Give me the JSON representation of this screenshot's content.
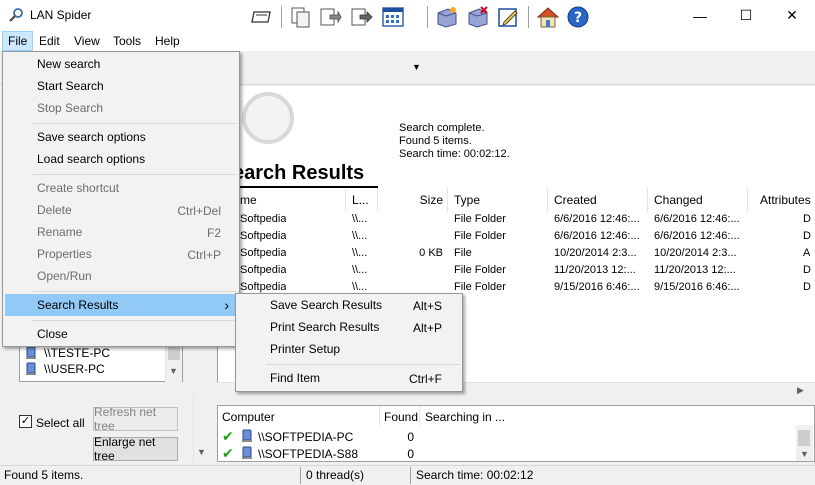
{
  "window": {
    "title": "LAN Spider",
    "minimize": "—",
    "maximize": "☐",
    "close": "✕"
  },
  "menubar": [
    "File",
    "Edit",
    "View",
    "Tools",
    "Help"
  ],
  "file_menu": {
    "items": [
      {
        "label": "New search",
        "shortcut": "",
        "disabled": false
      },
      {
        "label": "Start Search",
        "shortcut": "",
        "disabled": false
      },
      {
        "label": "Stop Search",
        "shortcut": "",
        "disabled": true
      },
      {
        "label": "Save search options",
        "shortcut": "",
        "disabled": false
      },
      {
        "label": "Load search options",
        "shortcut": "",
        "disabled": false
      },
      {
        "label": "Create shortcut",
        "shortcut": "",
        "disabled": true
      },
      {
        "label": "Delete",
        "shortcut": "Ctrl+Del",
        "disabled": true
      },
      {
        "label": "Rename",
        "shortcut": "F2",
        "disabled": true
      },
      {
        "label": "Properties",
        "shortcut": "Ctrl+P",
        "disabled": true
      },
      {
        "label": "Open/Run",
        "shortcut": "",
        "disabled": true
      },
      {
        "label": "Search Results",
        "shortcut": "›",
        "disabled": false
      },
      {
        "label": "Close",
        "shortcut": "",
        "disabled": false
      }
    ]
  },
  "submenu": {
    "items": [
      {
        "label": "Save Search Results",
        "shortcut": "Alt+S"
      },
      {
        "label": "Print Search Results",
        "shortcut": "Alt+P"
      },
      {
        "label": "Printer Setup",
        "shortcut": ""
      },
      {
        "label": "Find Item",
        "shortcut": "Ctrl+F"
      }
    ]
  },
  "status": {
    "line1": "Search complete.",
    "line2": "Found 5 items.",
    "line3": "Search time: 00:02:12."
  },
  "results": {
    "heading": "earch Results",
    "columns": [
      "me",
      "L...",
      "Size",
      "Type",
      "Created",
      "Changed",
      "Attributes"
    ],
    "rows": [
      [
        "Softpedia",
        "\\\\...",
        "",
        "File Folder",
        "6/6/2016 12:46:...",
        "6/6/2016 12:46:...",
        "D"
      ],
      [
        "Softpedia",
        "\\\\...",
        "",
        "File Folder",
        "6/6/2016 12:46:...",
        "6/6/2016 12:46:...",
        "D"
      ],
      [
        "Softpedia",
        "\\\\...",
        "0 KB",
        "File",
        "10/20/2014 2:3...",
        "10/20/2014 2:3...",
        "A"
      ],
      [
        "Softpedia",
        "\\\\...",
        "",
        "File Folder",
        "11/20/2013 12:...",
        "11/20/2013 12:...",
        "D"
      ],
      [
        "Softpedia",
        "\\\\...",
        "",
        "File Folder",
        "9/15/2016 6:46:...",
        "9/15/2016 6:46:...",
        "D"
      ]
    ]
  },
  "tree": {
    "items": [
      "\\\\TESTE-PC",
      "\\\\USER-PC"
    ]
  },
  "select_all": {
    "label": "Select all",
    "checked": true
  },
  "buttons": {
    "refresh": "Refresh net tree",
    "enlarge": "Enlarge net tree"
  },
  "computers": {
    "columns": [
      "Computer",
      "Found",
      "Searching in ..."
    ],
    "rows": [
      {
        "name": "\\\\SOFTPEDIA-PC",
        "found": "0"
      },
      {
        "name": "\\\\SOFTPEDIA-S88",
        "found": "0"
      }
    ]
  },
  "statusbar": {
    "found": "Found 5 items.",
    "threads": "0 thread(s)",
    "time": "Search time: 00:02:12"
  },
  "icons": [
    "spider-icon",
    "form-icon",
    "copy-icon",
    "move-icon",
    "export-icon",
    "view-icon",
    "box-add-icon",
    "box-delete-icon",
    "edit-icon",
    "home-icon",
    "help-icon",
    "computer-icon",
    "check-icon",
    "magnifier-icon"
  ]
}
